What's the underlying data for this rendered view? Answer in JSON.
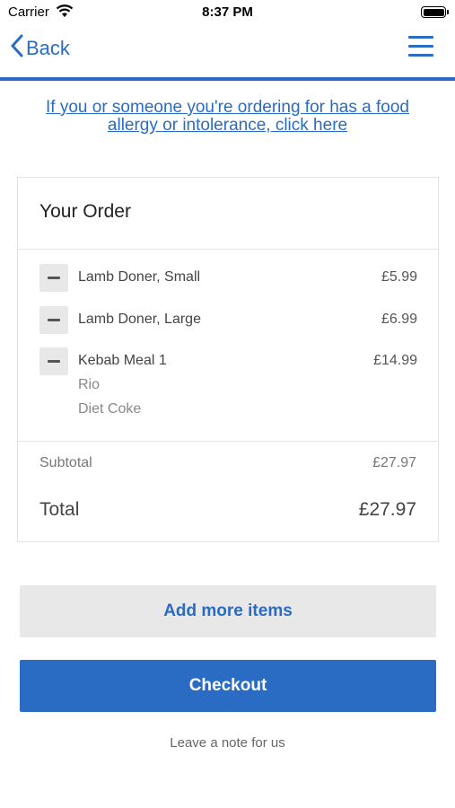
{
  "status_bar": {
    "carrier": "Carrier",
    "time": "8:37 PM"
  },
  "nav": {
    "back_label": "Back",
    "accent_color": "#2a6bc4"
  },
  "allergy_link": {
    "line1": "If you or someone you're ordering for has a food",
    "line2": "allergy or intolerance, click here"
  },
  "order": {
    "title": "Your Order",
    "items": [
      {
        "name": "Lamb Doner, Small",
        "price": "£5.99",
        "options": []
      },
      {
        "name": "Lamb Doner, Large",
        "price": "£6.99",
        "options": []
      },
      {
        "name": "Kebab Meal 1",
        "price": "£14.99",
        "options": [
          "Rio",
          "Diet Coke"
        ]
      }
    ],
    "subtotal_label": "Subtotal",
    "subtotal_value": "£27.97",
    "total_label": "Total",
    "total_value": "£27.97"
  },
  "actions": {
    "add_more_label": "Add more items",
    "checkout_label": "Checkout",
    "leave_note_label": "Leave a note for us"
  }
}
